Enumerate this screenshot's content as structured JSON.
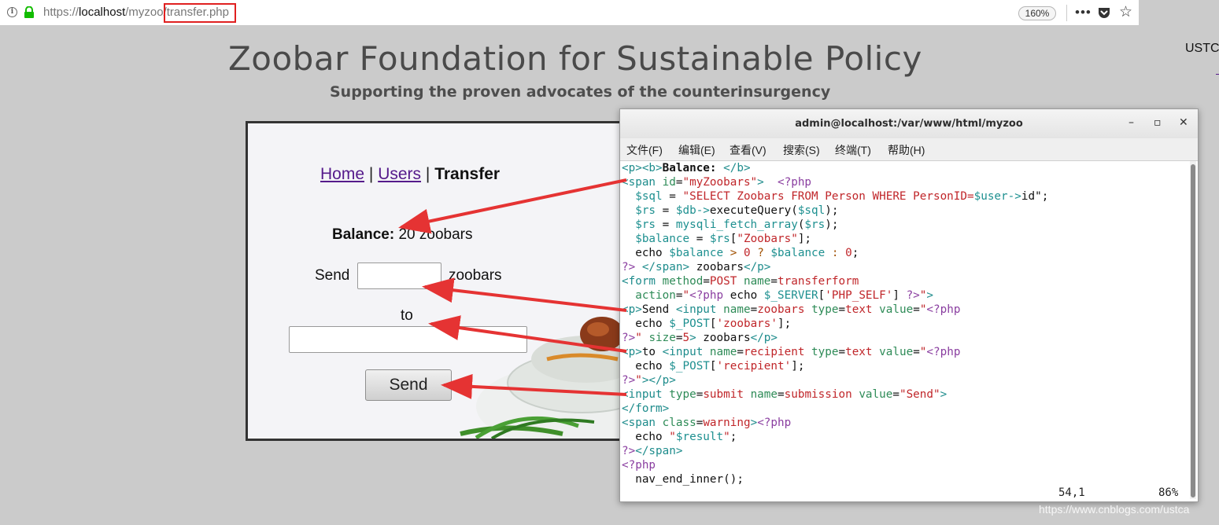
{
  "browser": {
    "url_prefix": "https://",
    "url_host": "localhost",
    "url_path": "/myzoo/",
    "url_file": "transfer.php",
    "zoom": "160%"
  },
  "site": {
    "title": "Zoobar Foundation for Sustainable Policy",
    "subtitle": "Supporting the proven advocates of the counterinsurgency",
    "corner_user": "USTC"
  },
  "nav": {
    "home": "Home",
    "users": "Users",
    "transfer": "Transfer",
    "sep": "|"
  },
  "form": {
    "balance_label": "Balance:",
    "balance_value": "20 zoobars",
    "send_label": "Send",
    "zoobars_unit": "zoobars",
    "to_label": "to",
    "send_button": "Send"
  },
  "terminal": {
    "title": "admin@localhost:/var/www/html/myzoo",
    "menu": [
      "文件(F)",
      "编辑(E)",
      "查看(V)",
      "搜索(S)",
      "终端(T)",
      "帮助(H)"
    ],
    "status_pos": "54,1",
    "status_pct": "86%"
  },
  "watermark": "https://www.cnblogs.com/ustca",
  "colors": {
    "arrow": "#e53333",
    "highlight": "#e02020",
    "link": "#551a8b"
  }
}
